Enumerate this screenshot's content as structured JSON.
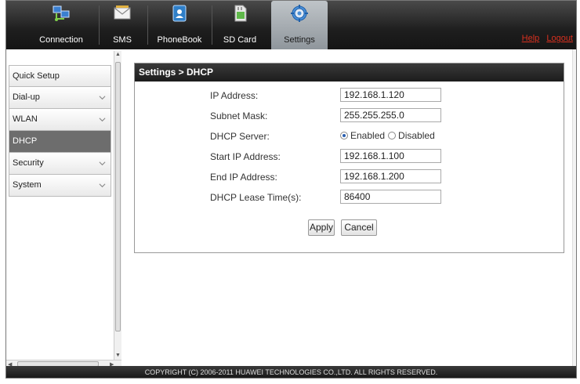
{
  "nav": {
    "tabs": [
      {
        "label": "Connection",
        "icon": "connection-icon",
        "active": false
      },
      {
        "label": "SMS",
        "icon": "envelope-icon",
        "active": false
      },
      {
        "label": "PhoneBook",
        "icon": "phonebook-icon",
        "active": false
      },
      {
        "label": "SD Card",
        "icon": "sd-card-icon",
        "active": false
      },
      {
        "label": "Settings",
        "icon": "gear-icon",
        "active": true
      }
    ],
    "help_label": "Help",
    "logout_label": "Logout"
  },
  "sidebar": {
    "items": [
      {
        "label": "Quick Setup",
        "has_chevron": false,
        "active": false
      },
      {
        "label": "Dial-up",
        "has_chevron": true,
        "active": false
      },
      {
        "label": "WLAN",
        "has_chevron": true,
        "active": false
      },
      {
        "label": "DHCP",
        "has_chevron": false,
        "active": true
      },
      {
        "label": "Security",
        "has_chevron": true,
        "active": false
      },
      {
        "label": "System",
        "has_chevron": true,
        "active": false
      }
    ]
  },
  "panel": {
    "title": "Settings > DHCP",
    "ip_address": {
      "label": "IP Address:",
      "value": "192.168.1.120"
    },
    "subnet_mask": {
      "label": "Subnet Mask:",
      "value": "255.255.255.0"
    },
    "dhcp_server": {
      "label": "DHCP Server:",
      "enabled_label": "Enabled",
      "disabled_label": "Disabled",
      "selected": "Enabled"
    },
    "start_ip": {
      "label": "Start IP Address:",
      "value": "192.168.1.100"
    },
    "end_ip": {
      "label": "End IP Address:",
      "value": "192.168.1.200"
    },
    "lease_time": {
      "label": "DHCP Lease Time(s):",
      "value": "86400"
    },
    "apply_label": "Apply",
    "cancel_label": "Cancel"
  },
  "footer": {
    "copyright": "COPYRIGHT (C) 2006-2011 HUAWEI TECHNOLOGIES CO.,LTD. ALL RIGHTS RESERVED."
  },
  "colors": {
    "accent_link": "#d8301f",
    "active_menu": "#6d6d6d",
    "topbar": "#1e1e1e"
  }
}
